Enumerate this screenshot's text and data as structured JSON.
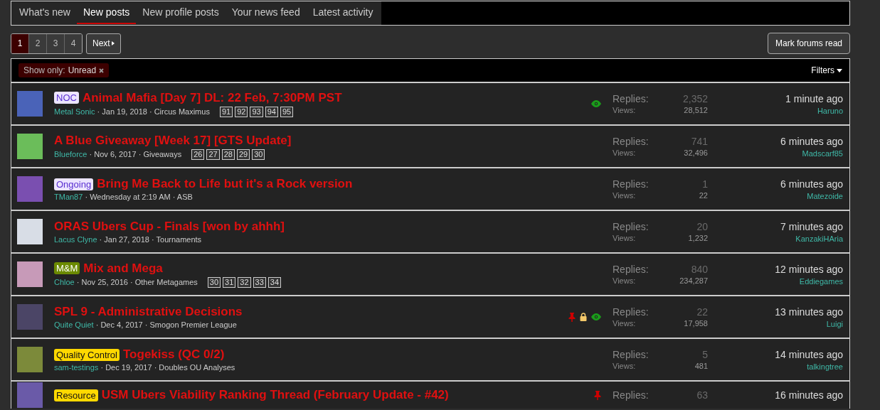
{
  "tabs": [
    {
      "label": "What's new",
      "selected": false
    },
    {
      "label": "New posts",
      "selected": true
    },
    {
      "label": "New profile posts",
      "selected": false
    },
    {
      "label": "Your news feed",
      "selected": false
    },
    {
      "label": "Latest activity",
      "selected": false
    }
  ],
  "pagination": {
    "pages": [
      {
        "label": "1",
        "selected": true
      },
      {
        "label": "2",
        "selected": false
      },
      {
        "label": "3",
        "selected": false
      },
      {
        "label": "4",
        "selected": false
      }
    ],
    "next": "Next"
  },
  "mark_read_button": "Mark forums read",
  "filter_bar": {
    "filter_label": "Show only:",
    "filter_value": "Unread",
    "filters_button": "Filters"
  },
  "threads": [
    {
      "prefix": {
        "label": "NOC",
        "color": "#ece4ff"
      },
      "title": "Animal Mafia [Day 7] DL: 22 Feb, 7:30PM PST",
      "author": "Metal Sonic",
      "date": "· Jan 19, 2018",
      "forum": "· Circus Maximus",
      "pages": [
        "91",
        "92",
        "93",
        "94",
        "95"
      ],
      "pinned": false,
      "locked": false,
      "watched": true,
      "replies_label": "Replies:",
      "replies": "2,352",
      "views_label": "Views:",
      "views": "28,512",
      "last_time": "1 minute ago",
      "last_poster": "Haruno"
    },
    {
      "title": "A Blue Giveaway [Week 17] [GTS Update]",
      "author": "Blueforce",
      "date": "· Nov 6, 2017",
      "forum": "· Giveaways",
      "pages": [
        "26",
        "27",
        "28",
        "29",
        "30"
      ],
      "pinned": false,
      "locked": false,
      "watched": false,
      "replies_label": "Replies:",
      "replies": "741",
      "views_label": "Views:",
      "views": "32,496",
      "last_time": "6 minutes ago",
      "last_poster": "Madscarf85"
    },
    {
      "prefix": {
        "label": "Ongoing",
        "color": "#ece4ff"
      },
      "title": "Bring Me Back to Life but it's a Rock version",
      "author": "TMan87",
      "date": "· Wednesday at 2:19 AM",
      "forum": "· ASB",
      "pinned": false,
      "locked": false,
      "watched": false,
      "replies_label": "Replies:",
      "replies": "1",
      "views_label": "Views:",
      "views": "22",
      "last_time": "6 minutes ago",
      "last_poster": "Matezoide"
    },
    {
      "title": "ORAS Ubers Cup - Finals [won by ahhh]",
      "author": "Lacus Clyne",
      "date": "· Jan 27, 2018",
      "forum": "· Tournaments",
      "pinned": false,
      "locked": false,
      "watched": false,
      "replies_label": "Replies:",
      "replies": "20",
      "views_label": "Views:",
      "views": "1,232",
      "last_time": "7 minutes ago",
      "last_poster": "KanzakiHAria"
    },
    {
      "prefix": {
        "label": "M&M",
        "color": "#6b8a00"
      },
      "title": "Mix and Mega",
      "author": "Chloe",
      "date": "· Nov 25, 2016",
      "forum": "· Other Metagames",
      "pages": [
        "30",
        "31",
        "32",
        "33",
        "34"
      ],
      "pinned": false,
      "locked": false,
      "watched": false,
      "replies_label": "Replies:",
      "replies": "840",
      "views_label": "Views:",
      "views": "234,287",
      "last_time": "12 minutes ago",
      "last_poster": "Eddiegames"
    },
    {
      "title": "SPL 9 - Administrative Decisions",
      "author": "Quite Quiet",
      "date": "· Dec 4, 2017",
      "forum": "· Smogon Premier League",
      "pinned": true,
      "locked": true,
      "watched": true,
      "replies_label": "Replies:",
      "replies": "22",
      "views_label": "Views:",
      "views": "17,958",
      "last_time": "13 minutes ago",
      "last_poster": "Luigi"
    },
    {
      "prefix": {
        "label": "Quality Control",
        "color": "#ffd800"
      },
      "title": "Togekiss (QC 0/2)",
      "author": "sam-testings",
      "date": "· Dec 19, 2017",
      "forum": "· Doubles OU Analyses",
      "pinned": false,
      "locked": false,
      "watched": false,
      "replies_label": "Replies:",
      "replies": "5",
      "views_label": "Views:",
      "views": "481",
      "last_time": "14 minutes ago",
      "last_poster": "talkingtree"
    },
    {
      "prefix": {
        "label": "Resource",
        "color": "#ffd800"
      },
      "title": "USM Ubers Viability Ranking Thread (February Update - #42)",
      "pinned": true,
      "locked": false,
      "watched": false,
      "replies_label": "Replies:",
      "replies": "63",
      "last_time": "16 minutes ago"
    }
  ]
}
